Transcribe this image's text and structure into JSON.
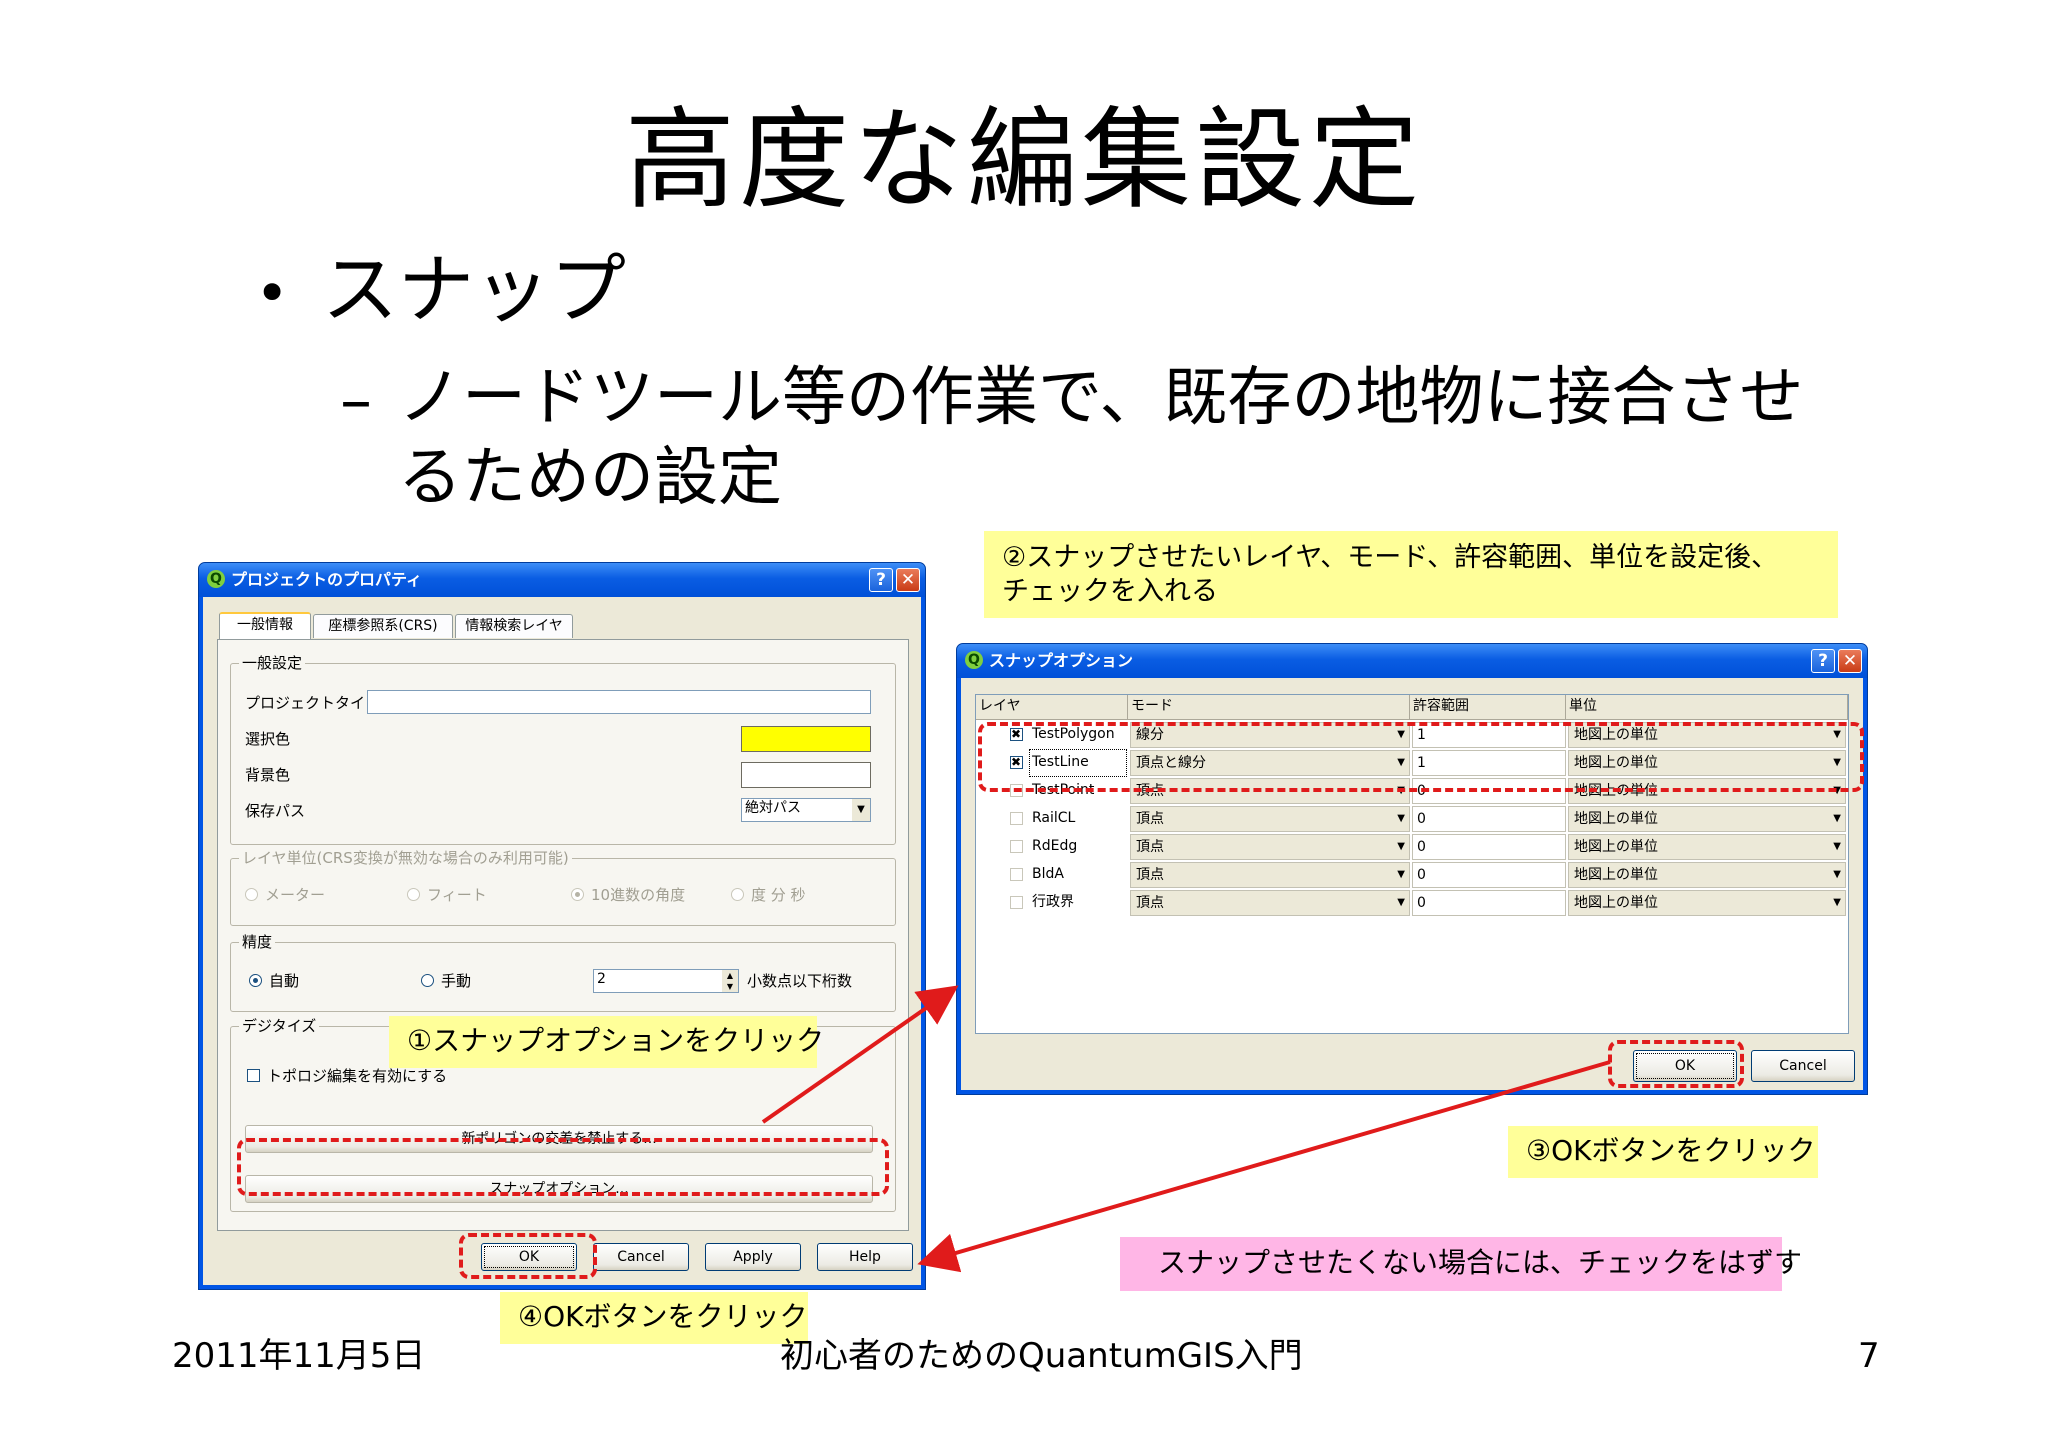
{
  "slide": {
    "title": "高度な編集設定",
    "bullet": "スナップ",
    "sub_bullet_dash": "–",
    "sub_bullet_line1": "ノードツール等の作業で、既存の地物に接合させ",
    "sub_bullet_line2": "るための設定",
    "footer_date": "2011年11月5日",
    "footer_title": "初心者のためのQuantumGIS入門",
    "page_number": "7"
  },
  "project_properties": {
    "title": "プロジェクトのプロパティ",
    "tabs": [
      "一般情報",
      "座標参照系(CRS)",
      "情報検索レイヤ"
    ],
    "general": {
      "group_title": "一般設定",
      "project_title_label": "プロジェクトタイトル",
      "project_title_value": "",
      "selection_color_label": "選択色",
      "selection_color": "#ffff00",
      "background_color_label": "背景色",
      "background_color": "#ffffff",
      "save_path_label": "保存パス",
      "save_path_value": "絶対パス"
    },
    "layer_units": {
      "group_title": "レイヤ単位(CRS変換が無効な場合のみ利用可能)",
      "options": [
        "メーター",
        "フィート",
        "10進数の角度",
        "度 分 秒"
      ],
      "selected": "10進数の角度"
    },
    "precision": {
      "group_title": "精度",
      "auto_label": "自動",
      "manual_label": "手動",
      "selected": "自動",
      "decimal_value": "2",
      "decimal_label": "小数点以下桁数"
    },
    "digitize": {
      "group_title": "デジタイズ",
      "topological_editing_label": "トポロジ編集を有効にする",
      "topological_editing_checked": false,
      "avoid_intersections_button": "新ポリゴンの交差を禁止する...",
      "snapping_options_button": "スナップオプション..."
    },
    "buttons": {
      "ok": "OK",
      "cancel": "Cancel",
      "apply": "Apply",
      "help": "Help"
    }
  },
  "snapping_options": {
    "title": "スナップオプション",
    "columns": [
      "レイヤ",
      "モード",
      "許容範囲",
      "単位"
    ],
    "rows": [
      {
        "checked": true,
        "layer": "TestPolygon",
        "mode": "線分",
        "tolerance": "1",
        "unit": "地図上の単位"
      },
      {
        "checked": true,
        "layer": "TestLine",
        "mode": "頂点と線分",
        "tolerance": "1",
        "unit": "地図上の単位"
      },
      {
        "checked": false,
        "layer": "TestPoint",
        "mode": "頂点",
        "tolerance": "0",
        "unit": "地図上の単位"
      },
      {
        "checked": false,
        "layer": "RailCL",
        "mode": "頂点",
        "tolerance": "0",
        "unit": "地図上の単位"
      },
      {
        "checked": false,
        "layer": "RdEdg",
        "mode": "頂点",
        "tolerance": "0",
        "unit": "地図上の単位"
      },
      {
        "checked": false,
        "layer": "BldA",
        "mode": "頂点",
        "tolerance": "0",
        "unit": "地図上の単位"
      },
      {
        "checked": false,
        "layer": "行政界",
        "mode": "頂点",
        "tolerance": "0",
        "unit": "地図上の単位"
      }
    ],
    "buttons": {
      "ok": "OK",
      "cancel": "Cancel"
    }
  },
  "callouts": {
    "step1": "①スナップオプションをクリック",
    "step2_line1": "②スナップさせたいレイヤ、モード、許容範囲、単位を設定後、",
    "step2_line2": "チェックを入れる",
    "step3": "③OKボタンをクリック",
    "step4": "④OKボタンをクリック",
    "uncheck_note": "スナップさせたくない場合には、チェックをはずす"
  },
  "colors": {
    "callout_yellow": "#ffff99",
    "callout_pink": "#ffb6e6",
    "annotation_red": "#e01b1b",
    "xp_titlebar_blue": "#0a5de3"
  }
}
